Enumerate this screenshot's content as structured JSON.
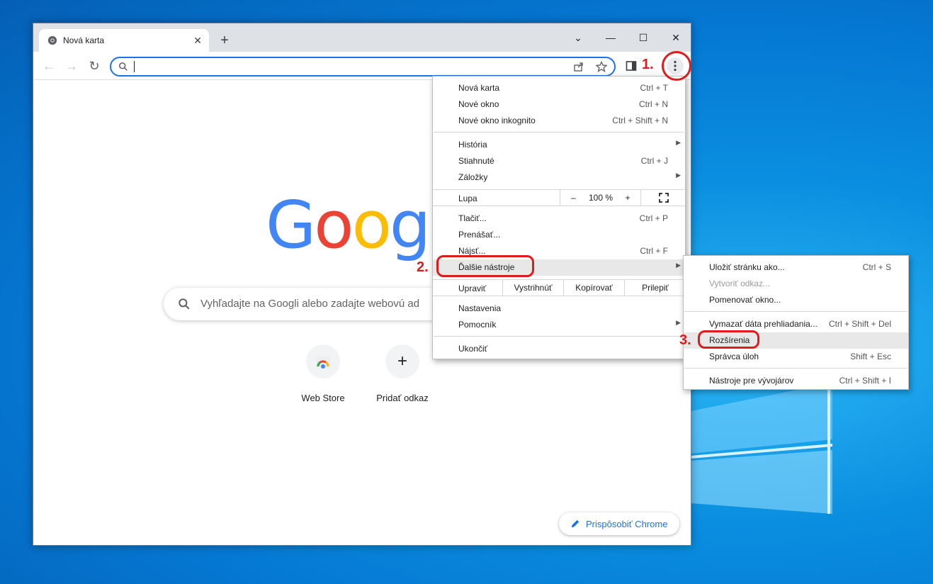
{
  "browser": {
    "tab_title": "Nová karta",
    "new_tab": "+",
    "close_tab": "✕",
    "omnibox_value": ""
  },
  "page": {
    "logo_text": "Google",
    "search_placeholder": "Vyhľadajte na Googli alebo zadajte webovú ad",
    "shortcuts": [
      {
        "label": "Web Store"
      },
      {
        "label": "Pridať odkaz"
      }
    ],
    "customize_label": "Prispôsobiť Chrome"
  },
  "main_menu": {
    "items": [
      {
        "label": "Nová karta",
        "shortcut": "Ctrl + T"
      },
      {
        "label": "Nové okno",
        "shortcut": "Ctrl + N"
      },
      {
        "label": "Nové okno inkognito",
        "shortcut": "Ctrl + Shift + N"
      },
      {
        "label": "História",
        "shortcut": ""
      },
      {
        "label": "Stiahnuté",
        "shortcut": "Ctrl + J"
      },
      {
        "label": "Záložky",
        "shortcut": ""
      },
      {
        "label": "Tlačiť...",
        "shortcut": "Ctrl + P"
      },
      {
        "label": "Prenášať...",
        "shortcut": ""
      },
      {
        "label": "Nájsť...",
        "shortcut": "Ctrl + F"
      },
      {
        "label": "Ďalšie nástroje",
        "shortcut": ""
      },
      {
        "label": "Nastavenia",
        "shortcut": ""
      },
      {
        "label": "Pomocník",
        "shortcut": ""
      },
      {
        "label": "Ukončiť",
        "shortcut": ""
      }
    ],
    "zoom": {
      "label": "Lupa",
      "minus": "–",
      "value": "100 %",
      "plus": "+"
    },
    "edit": {
      "label": "Upraviť",
      "cut": "Vystrihnúť",
      "copy": "Kopírovať",
      "paste": "Prilepiť"
    }
  },
  "sub_menu": {
    "items": [
      {
        "label": "Uložiť stránku ako...",
        "shortcut": "Ctrl + S"
      },
      {
        "label": "Vytvoriť odkaz...",
        "shortcut": ""
      },
      {
        "label": "Pomenovať okno...",
        "shortcut": ""
      },
      {
        "label": "Vymazať dáta prehliadania...",
        "shortcut": "Ctrl + Shift + Del"
      },
      {
        "label": "Rozšírenia",
        "shortcut": ""
      },
      {
        "label": "Správca úloh",
        "shortcut": "Shift + Esc"
      },
      {
        "label": "Nástroje pre vývojárov",
        "shortcut": "Ctrl + Shift + I"
      }
    ]
  },
  "annotations": {
    "step1": "1.",
    "step2": "2.",
    "step3": "3."
  },
  "colors": {
    "accent": "#1a73e8",
    "annotation_red": "#e01b1b",
    "google_blue": "#4285f4",
    "google_red": "#ea4335",
    "google_yellow": "#fbbc05",
    "google_green": "#34a853"
  }
}
